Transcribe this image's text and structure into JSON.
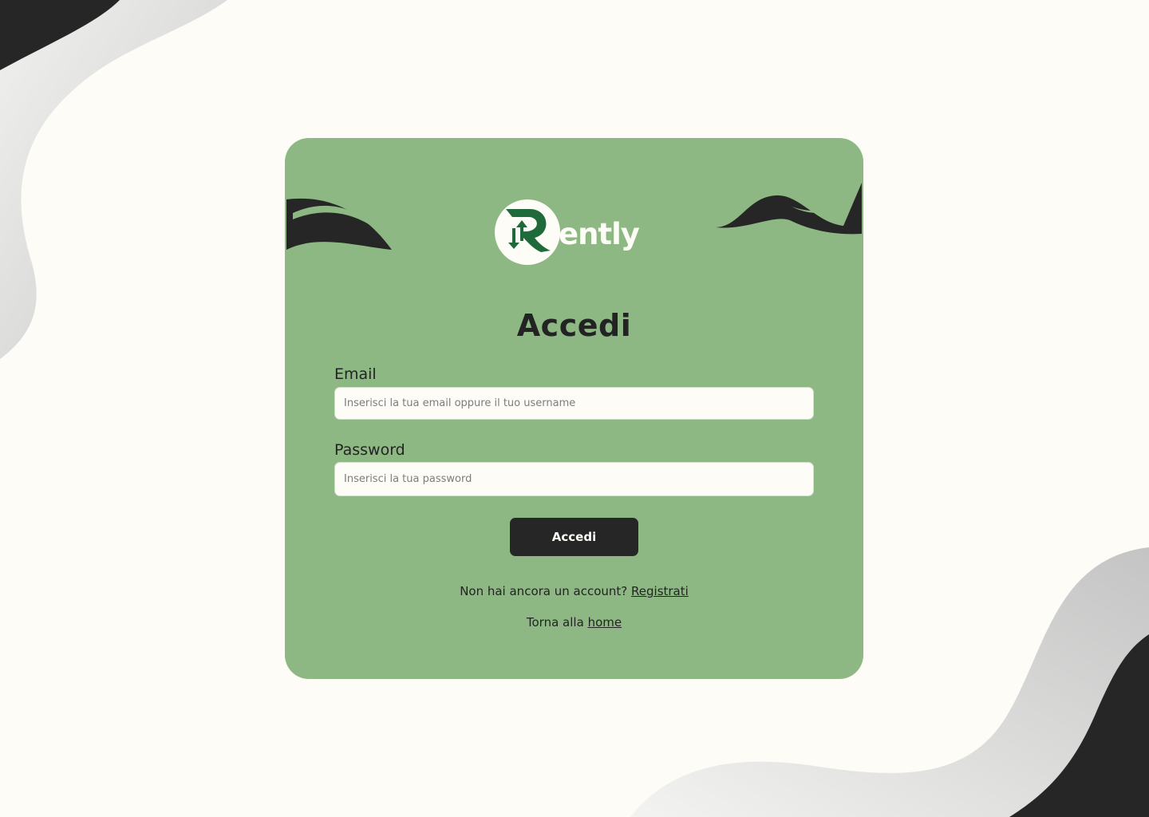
{
  "brand": {
    "name": "ently",
    "logo_icon": "rently-logo-icon",
    "primary_color": "#8db883",
    "dark_color": "#262626",
    "logo_green": "#1f6a3a"
  },
  "login": {
    "title": "Accedi",
    "email_label": "Email",
    "email_placeholder": "Inserisci la tua email oppure il tuo username",
    "password_label": "Password",
    "password_placeholder": "Inserisci la tua password",
    "submit_label": "Accedi",
    "signup_prompt": "Non hai ancora un account?",
    "signup_link": "Registrati",
    "home_prompt": "Torna alla",
    "home_link": "home"
  }
}
